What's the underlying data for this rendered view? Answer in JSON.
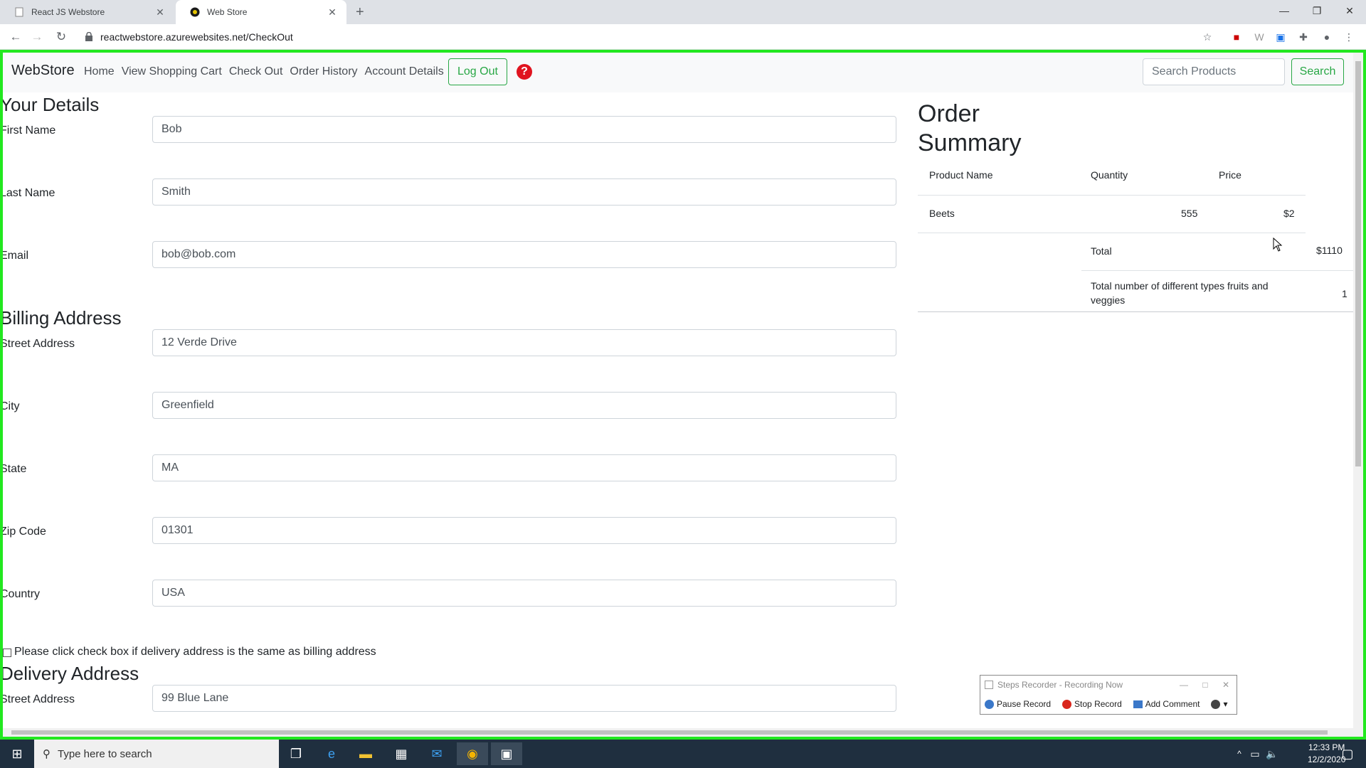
{
  "browser": {
    "tabs": [
      {
        "title": "React JS Webstore",
        "active": false
      },
      {
        "title": "Web Store",
        "active": true
      }
    ],
    "url": "reactwebstore.azurewebsites.net/CheckOut"
  },
  "navbar": {
    "brand": "WebStore",
    "links": [
      "Home",
      "View Shopping Cart",
      "Check Out",
      "Order History",
      "Account Details"
    ],
    "logout_label": "Log Out",
    "help_icon": "help-circle-icon",
    "search_placeholder": "Search Products",
    "search_label": "Search",
    "accent_color": "#28a745"
  },
  "details": {
    "heading": "Your Details",
    "first_name": {
      "label": "First Name",
      "value": "Bob"
    },
    "last_name": {
      "label": "Last Name",
      "value": "Smith"
    },
    "email": {
      "label": "Email",
      "value": "bob@bob.com"
    }
  },
  "billing": {
    "heading": "Billing Address",
    "street": {
      "label": "Street Address",
      "value": "12 Verde Drive"
    },
    "city": {
      "label": "City",
      "value": "Greenfield"
    },
    "state": {
      "label": "State",
      "value": "MA"
    },
    "zip": {
      "label": "Zip Code",
      "value": "01301"
    },
    "country": {
      "label": "Country",
      "value": "USA"
    }
  },
  "same_address_label": "Please click check box if delivery address is the same as billing address",
  "delivery": {
    "heading": "Delivery Address",
    "street": {
      "label": "Street Address",
      "value": "99 Blue Lane"
    }
  },
  "summary": {
    "heading_line1": "Order",
    "heading_line2": "Summary",
    "headers": {
      "product": "Product Name",
      "quantity": "Quantity",
      "price": "Price"
    },
    "rows": [
      {
        "product": "Beets",
        "quantity": "555",
        "price": "$2"
      }
    ],
    "total_label": "Total",
    "total_value": "$1110",
    "types_label": "Total number of different types fruits and veggies",
    "types_value": "1"
  },
  "steps_recorder": {
    "title": "Steps Recorder - Recording Now",
    "pause": "Pause Record",
    "stop": "Stop Record",
    "comment": "Add Comment"
  },
  "taskbar": {
    "search_placeholder": "Type here to search",
    "time": "12:33 PM",
    "date": "12/2/2020"
  }
}
